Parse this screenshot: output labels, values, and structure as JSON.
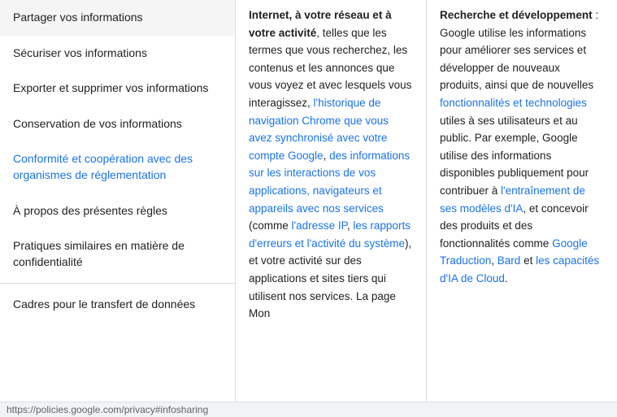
{
  "sidebar": {
    "items": [
      {
        "id": "partager",
        "label": "Partager vos informations",
        "active": false
      },
      {
        "id": "securiser",
        "label": "Sécuriser vos informations",
        "active": false
      },
      {
        "id": "exporter",
        "label": "Exporter et supprimer vos informations",
        "active": false
      },
      {
        "id": "conservation",
        "label": "Conservation de vos informations",
        "active": false
      },
      {
        "id": "conformite",
        "label": "Conformité et coopération avec des organismes de réglementation",
        "active": true
      },
      {
        "id": "apropos",
        "label": "À propos des présentes règles",
        "active": false
      },
      {
        "id": "pratiques",
        "label": "Pratiques similaires en matière de confidentialité",
        "active": false
      },
      {
        "id": "cadres",
        "label": "Cadres pour le transfert de données",
        "active": false
      }
    ]
  },
  "col_left": {
    "content": "Internet, à votre réseau et à votre activité, telles que les termes que vous recherchez, les contenus et les annonces que vous voyez et avec lesquels vous interagissez, l'historique de navigation Chrome que vous avez synchronisé avec votre compte Google, des informations sur les interactions de vos applications, navigateurs et appareils avec nos services (comme l'adresse IP, les rapports d'erreurs et l'activité du système), et votre activité sur des applications et sites tiers qui utilisent nos services. La page Mon",
    "bold_parts": [
      "Internet, à votre réseau et à votre activité"
    ],
    "links": [
      "l'historique de navigation Chrome que vous avez synchronisé avec votre compte Google",
      "des informations sur les interactions de vos applications, navigateurs et appareils avec nos services",
      "l'adresse IP",
      "les rapports d'erreurs et l'activité du système"
    ]
  },
  "col_right": {
    "title": "Recherche et développement",
    "title_suffix": " : Google utilise les informations pour améliorer ses services et développer de nouveaux produits, ainsi que de nouvelles fonctionnalités et technologies utiles à ses utilisateurs et au public. Par exemple, Google utilise des informations disponibles publiquement pour contribuer à l'entraînement de ses modèles d'IA, et concevoir des produits et des fonctionnalités comme Google Traduction, Bard et les capacités d'IA de Cloud.",
    "links": [
      "fonctionnalités et technologies",
      "l'entraînement de ses modèles d'IA",
      "Google Traduction",
      "Bard",
      "les capacités d'IA de Cloud"
    ]
  },
  "statusbar": {
    "url": "https://policies.google.com/privacy#infosharing"
  }
}
